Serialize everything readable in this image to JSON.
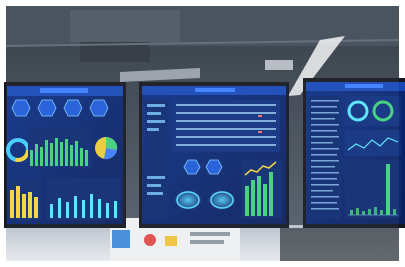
{
  "scene": {
    "colors": {
      "ceiling": "#3a4652",
      "screen_bezel": "#1a1f2a",
      "dashboard_bg": "#0a2a7a",
      "dashboard_header": "#1e6cff",
      "bar_green": "#3ed07a",
      "bar_yellow": "#f2d43a",
      "line_cyan": "#56e4ff",
      "floor": "#d8dde3"
    }
  }
}
